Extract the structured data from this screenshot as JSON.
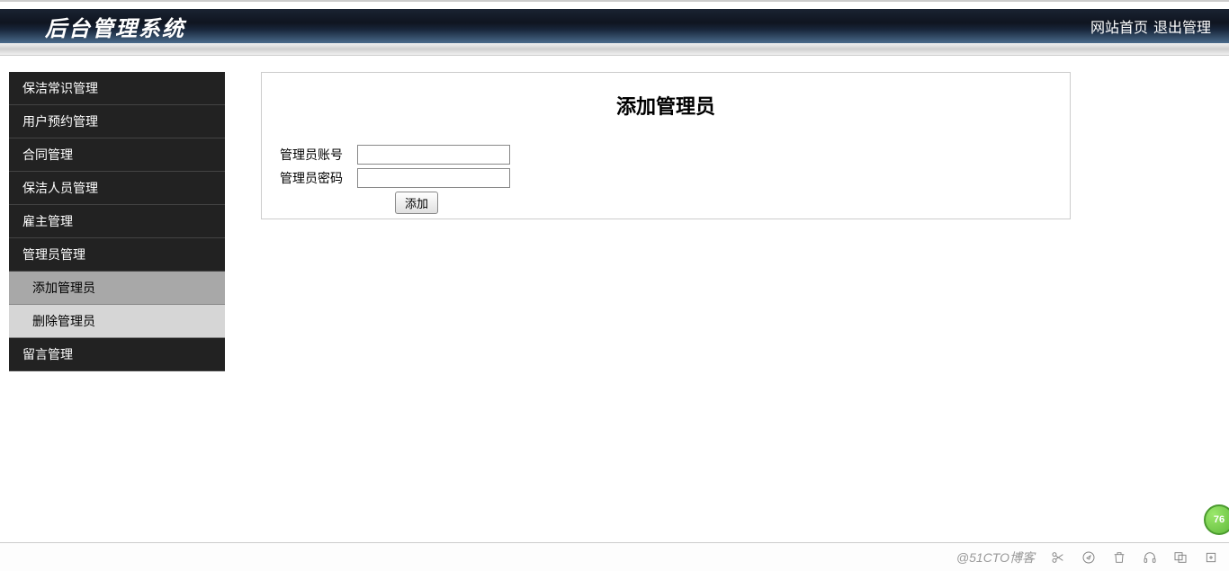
{
  "header": {
    "title": "后台管理系统",
    "links": {
      "home": "网站首页",
      "logout": "退出管理"
    }
  },
  "sidebar": {
    "items": [
      {
        "label": "保洁常识管理",
        "type": "main"
      },
      {
        "label": "用户预约管理",
        "type": "main"
      },
      {
        "label": "合同管理",
        "type": "main"
      },
      {
        "label": "保洁人员管理",
        "type": "main"
      },
      {
        "label": "雇主管理",
        "type": "main"
      },
      {
        "label": "管理员管理",
        "type": "main"
      },
      {
        "label": "添加管理员",
        "type": "sub",
        "active": true
      },
      {
        "label": "删除管理员",
        "type": "sub",
        "active": false
      },
      {
        "label": "留言管理",
        "type": "main"
      }
    ]
  },
  "main": {
    "title": "添加管理员",
    "form": {
      "account_label": "管理员账号",
      "password_label": "管理员密码",
      "account_value": "",
      "password_value": "",
      "submit_label": "添加"
    }
  },
  "footer": {
    "watermark": "@51CTO博客",
    "badge": "76"
  }
}
